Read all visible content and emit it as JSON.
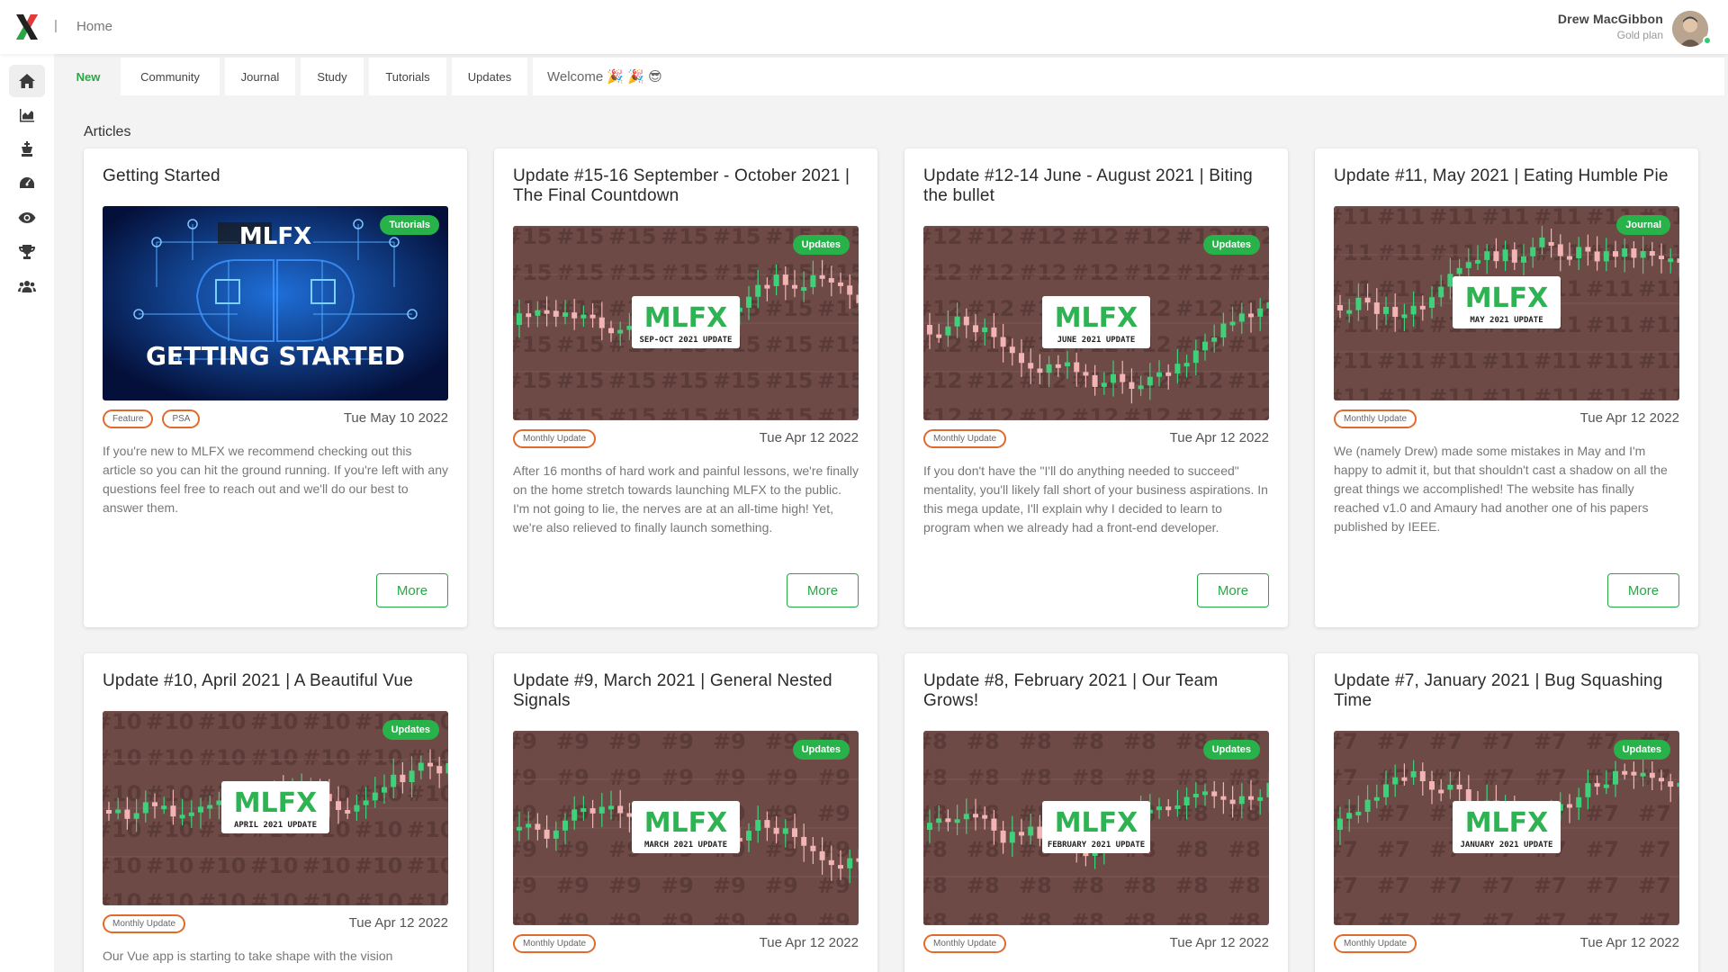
{
  "header": {
    "breadcrumb": "Home",
    "user_name": "Drew MacGibbon",
    "user_plan": "Gold plan"
  },
  "sidebar": {
    "items": [
      {
        "icon": "home-icon",
        "active": true
      },
      {
        "icon": "chart-area-icon",
        "active": false
      },
      {
        "icon": "chess-king-icon",
        "active": false
      },
      {
        "icon": "gauge-icon",
        "active": false
      },
      {
        "icon": "eye-icon",
        "active": false
      },
      {
        "icon": "trophy-icon",
        "active": false
      },
      {
        "icon": "users-icon",
        "active": false
      }
    ]
  },
  "tabs": [
    "New",
    "Community",
    "Journal",
    "Study",
    "Tutorials",
    "Updates"
  ],
  "welcome": "Welcome 🎉 🎉 😎",
  "section_title": "Articles",
  "colors": {
    "accent": "#27a844",
    "tag_border": "#e06a2b",
    "thumb_bg": "#6e4a47"
  },
  "articles": [
    {
      "title": "Getting Started",
      "category": "Tutorials",
      "image_text": "GETTING STARTED",
      "image_logo": "MLFX",
      "tags": [
        "Feature",
        "PSA"
      ],
      "date": "Tue May 10 2022",
      "description": "If you're new to MLFX we recommend checking out this article so you can hit the ground running. If you're left with any questions feel free to reach out and we'll do our best to answer them.",
      "more": "More"
    },
    {
      "title": "Update #15-16 September - October 2021 | The Final Countdown",
      "category": "Updates",
      "image_subtitle": "SEP-OCT 2021 UPDATE",
      "image_bg_text": "#15",
      "image_logo": "MLFX",
      "tags": [
        "Monthly Update"
      ],
      "date": "Tue Apr 12 2022",
      "description": "After 16 months of hard work and painful lessons, we're finally on the home stretch towards launching MLFX to the public. I'm not going to lie, the nerves are at an all-time high! Yet, we're also relieved to finally launch something.",
      "more": "More"
    },
    {
      "title": "Update #12-14 June - August 2021 | Biting the bullet",
      "category": "Updates",
      "image_subtitle": "JUNE 2021 UPDATE",
      "image_bg_text": "#12",
      "image_logo": "MLFX",
      "tags": [
        "Monthly Update"
      ],
      "date": "Tue Apr 12 2022",
      "description": "If you don't have the \"I'll do anything needed to succeed\" mentality, you'll likely fall short of your business aspirations. In this mega update, I'll explain why I decided to learn to program when we already had a front-end developer.",
      "more": "More"
    },
    {
      "title": "Update #11, May 2021 | Eating Humble Pie",
      "category": "Journal",
      "image_subtitle": "MAY 2021 UPDATE",
      "image_bg_text": "#11",
      "image_logo": "MLFX",
      "tags": [
        "Monthly Update"
      ],
      "date": "Tue Apr 12 2022",
      "description": "We (namely Drew) made some mistakes in May and I'm happy to admit it, but that shouldn't cast a shadow on all the great things we accomplished! The website has finally reached v1.0 and Amaury had another one of his papers published by IEEE.",
      "more": "More"
    },
    {
      "title": "Update #10, April 2021 | A Beautiful Vue",
      "category": "Updates",
      "image_subtitle": "APRIL 2021 UPDATE",
      "image_bg_text": "#10",
      "image_logo": "MLFX",
      "tags": [
        "Monthly Update"
      ],
      "date": "Tue Apr 12 2022",
      "description": "Our Vue app is starting to take shape with the vision",
      "more": "More"
    },
    {
      "title": "Update #9, March 2021 | General Nested Signals",
      "category": "Updates",
      "image_subtitle": "MARCH 2021 UPDATE",
      "image_bg_text": "#9",
      "image_logo": "MLFX",
      "tags": [
        "Monthly Update"
      ],
      "date": "Tue Apr 12 2022",
      "description": "",
      "more": "More"
    },
    {
      "title": "Update #8, February 2021 | Our Team Grows!",
      "category": "Updates",
      "image_subtitle": "FEBRUARY 2021 UPDATE",
      "image_bg_text": "#8",
      "image_logo": "MLFX",
      "tags": [
        "Monthly Update"
      ],
      "date": "Tue Apr 12 2022",
      "description": "",
      "more": "More"
    },
    {
      "title": "Update #7, January 2021 | Bug Squashing Time",
      "category": "Updates",
      "image_subtitle": "JANUARY 2021 UPDATE",
      "image_bg_text": "#7",
      "image_logo": "MLFX",
      "tags": [
        "Monthly Update"
      ],
      "date": "Tue Apr 12 2022",
      "description": "",
      "more": "More"
    }
  ]
}
